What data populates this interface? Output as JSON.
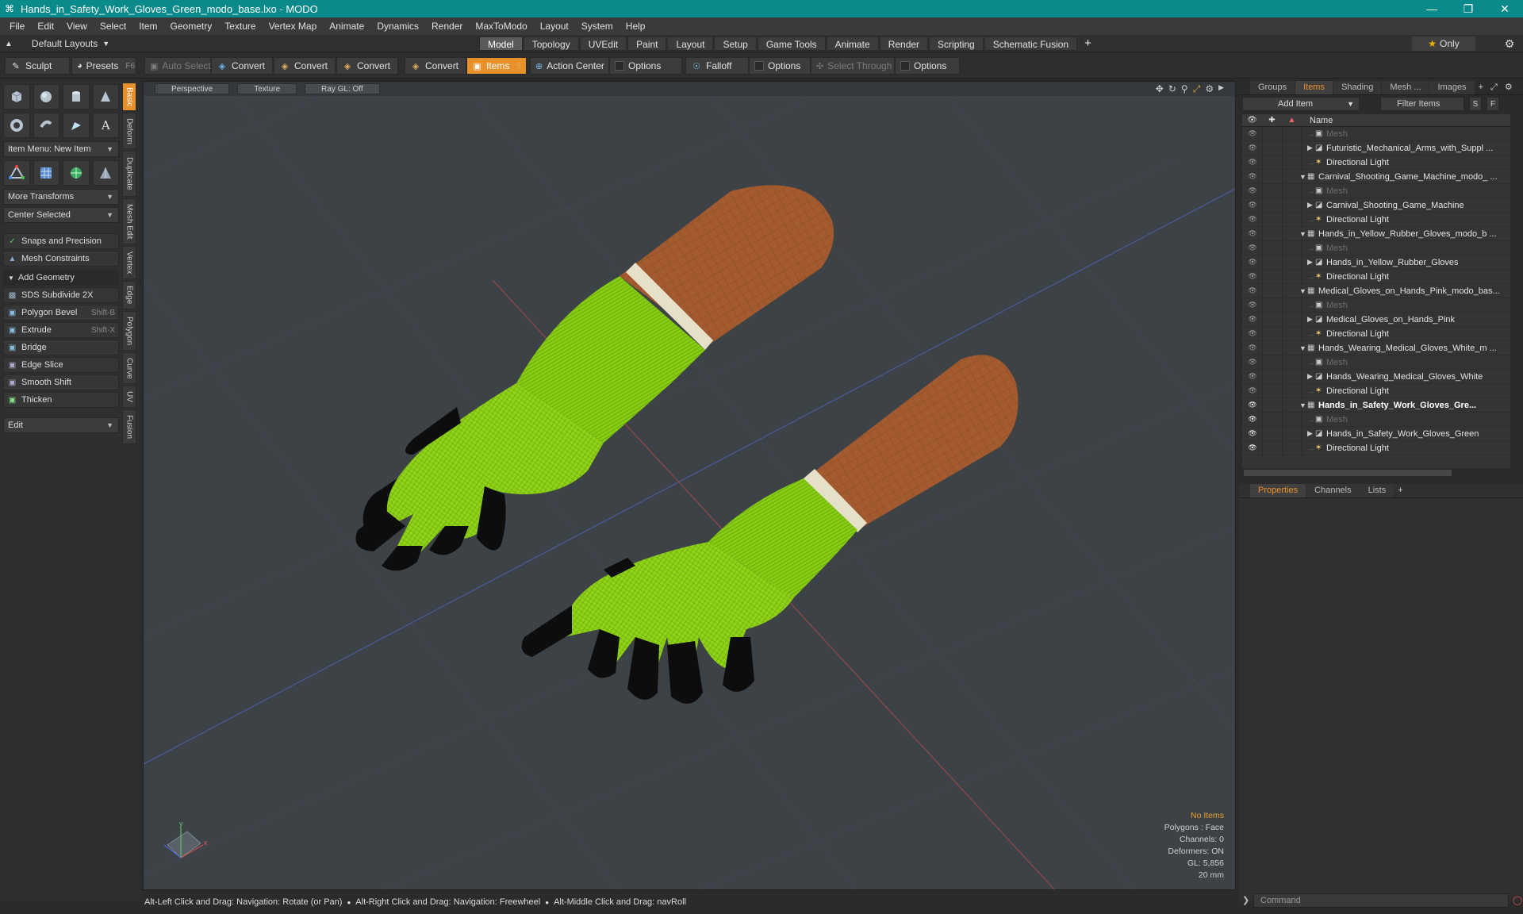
{
  "window": {
    "title": "Hands_in_Safety_Work_Gloves_Green_modo_base.lxo - MODO",
    "app_icon": "modo-logo-icon",
    "controls": [
      "minimize-icon",
      "maximize-icon",
      "close-icon"
    ]
  },
  "menu": [
    "File",
    "Edit",
    "View",
    "Select",
    "Item",
    "Geometry",
    "Texture",
    "Vertex Map",
    "Animate",
    "Dynamics",
    "Render",
    "MaxToModo",
    "Layout",
    "System",
    "Help"
  ],
  "layout_bar": {
    "layouts_label": "Default Layouts",
    "tabs": [
      "Model",
      "Topology",
      "UVEdit",
      "Paint",
      "Layout",
      "Setup",
      "Game Tools",
      "Animate",
      "Render",
      "Scripting",
      "Schematic Fusion"
    ],
    "active_tab": "Model",
    "add_tab": "+",
    "only_label": "Only"
  },
  "toolbar": {
    "sculpt": "Sculpt",
    "presets": "Presets",
    "presets_key": "F6",
    "auto_select": "Auto Select",
    "convert1": "Convert",
    "convert2": "Convert",
    "convert3": "Convert",
    "convert4": "Convert",
    "items": "Items",
    "items_key": "5",
    "action_center": "Action Center",
    "options1": "Options",
    "falloff": "Falloff",
    "options2": "Options",
    "select_through": "Select Through",
    "options3": "Options"
  },
  "left_panel": {
    "item_menu": "Item Menu: New Item",
    "more_transforms": "More Transforms",
    "center_selected": "Center Selected",
    "snaps": "Snaps and Precision",
    "mesh_constraints": "Mesh Constraints",
    "add_geometry": "Add Geometry",
    "tools": [
      {
        "label": "SDS Subdivide 2X",
        "shortcut": ""
      },
      {
        "label": "Polygon Bevel",
        "shortcut": "Shift-B"
      },
      {
        "label": "Extrude",
        "shortcut": "Shift-X"
      },
      {
        "label": "Bridge",
        "shortcut": ""
      },
      {
        "label": "Edge Slice",
        "shortcut": ""
      },
      {
        "label": "Smooth Shift",
        "shortcut": ""
      },
      {
        "label": "Thicken",
        "shortcut": ""
      }
    ],
    "edit_dropdown": "Edit",
    "vertical_tabs": [
      "Basic",
      "Deform",
      "Duplicate",
      "Mesh Edit",
      "Vertex",
      "Edge",
      "Polygon",
      "Curve",
      "UV",
      "Fusion"
    ]
  },
  "viewport": {
    "perspective": "Perspective",
    "texture": "Texture",
    "raygl": "Ray GL: Off",
    "info": {
      "no_items": "No Items",
      "polygons": "Polygons : Face",
      "channels": "Channels: 0",
      "deformers": "Deformers: ON",
      "gl": "GL: 5,856",
      "scale": "20 mm"
    },
    "colors": {
      "glove_green": "#8fd317",
      "glove_dark": "#0d0d0d",
      "arm_skin": "#a25a2e",
      "cuff": "#e6e0c8",
      "background": "#3d4247"
    }
  },
  "status_bar": {
    "hint1": "Alt-Left Click and Drag: Navigation: Rotate (or Pan)",
    "hint2": "Alt-Right Click and Drag: Navigation: Freewheel",
    "hint3": "Alt-Middle Click and Drag: navRoll"
  },
  "items_panel": {
    "tabs": [
      "Groups",
      "Items",
      "Shading",
      "Mesh ...",
      "Images"
    ],
    "active_tab": "Items",
    "add_item": "Add Item",
    "filter": "Filter Items",
    "s_btn": "S",
    "f_btn": "F",
    "name_header": "Name",
    "rows": [
      {
        "label": "Mesh",
        "kind": "mesh",
        "indent": 2
      },
      {
        "label": "Futuristic_Mechanical_Arms_with_Suppl ...",
        "kind": "item",
        "indent": 2,
        "twisty": "▶"
      },
      {
        "label": "Directional Light",
        "kind": "light",
        "indent": 2
      },
      {
        "label": "Carnival_Shooting_Game_Machine_modo_ ...",
        "kind": "scene",
        "indent": 1,
        "twisty": "▼"
      },
      {
        "label": "Mesh",
        "kind": "mesh",
        "indent": 2
      },
      {
        "label": "Carnival_Shooting_Game_Machine",
        "kind": "item",
        "indent": 2,
        "twisty": "▶"
      },
      {
        "label": "Directional Light",
        "kind": "light",
        "indent": 2
      },
      {
        "label": "Hands_in_Yellow_Rubber_Gloves_modo_b ...",
        "kind": "scene",
        "indent": 1,
        "twisty": "▼"
      },
      {
        "label": "Mesh",
        "kind": "mesh",
        "indent": 2
      },
      {
        "label": "Hands_in_Yellow_Rubber_Gloves",
        "kind": "item",
        "indent": 2,
        "twisty": "▶"
      },
      {
        "label": "Directional Light",
        "kind": "light",
        "indent": 2
      },
      {
        "label": "Medical_Gloves_on_Hands_Pink_modo_bas...",
        "kind": "scene",
        "indent": 1,
        "twisty": "▼"
      },
      {
        "label": "Mesh",
        "kind": "mesh",
        "indent": 2
      },
      {
        "label": "Medical_Gloves_on_Hands_Pink",
        "kind": "item",
        "indent": 2,
        "twisty": "▶"
      },
      {
        "label": "Directional Light",
        "kind": "light",
        "indent": 2
      },
      {
        "label": "Hands_Wearing_Medical_Gloves_White_m ...",
        "kind": "scene",
        "indent": 1,
        "twisty": "▼"
      },
      {
        "label": "Mesh",
        "kind": "mesh",
        "indent": 2
      },
      {
        "label": "Hands_Wearing_Medical_Gloves_White",
        "kind": "item",
        "indent": 2,
        "twisty": "▶"
      },
      {
        "label": "Directional Light",
        "kind": "light",
        "indent": 2
      },
      {
        "label": "Hands_in_Safety_Work_Gloves_Gre...",
        "kind": "scene",
        "indent": 1,
        "twisty": "▼",
        "bold": true
      },
      {
        "label": "Mesh",
        "kind": "mesh",
        "indent": 2
      },
      {
        "label": "Hands_in_Safety_Work_Gloves_Green",
        "kind": "item",
        "indent": 2,
        "twisty": "▶"
      },
      {
        "label": "Directional Light",
        "kind": "light",
        "indent": 2
      }
    ]
  },
  "properties_panel": {
    "tabs": [
      "Properties",
      "Channels",
      "Lists"
    ],
    "active_tab": "Properties",
    "add_tab": "+",
    "command_placeholder": "Command"
  }
}
